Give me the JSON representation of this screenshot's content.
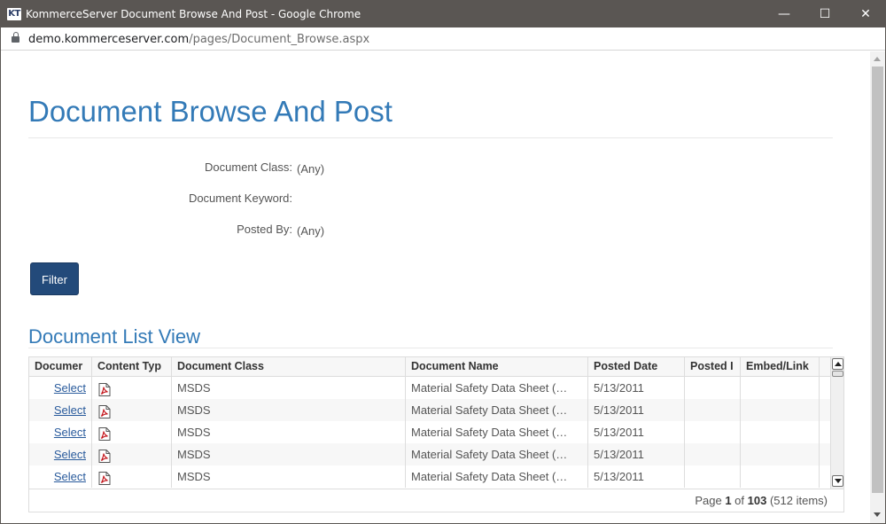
{
  "window": {
    "title": "KommerceServer Document Browse And Post - Google Chrome",
    "logo": "KT",
    "controls": {
      "minimize": "—",
      "maximize": "☐",
      "close": "✕"
    }
  },
  "address": {
    "host": "demo.kommerceserver.com",
    "path": "/pages/Document_Browse.aspx"
  },
  "page": {
    "title": "Document Browse And Post",
    "filters": [
      {
        "label": "Document Class:",
        "value": "(Any)"
      },
      {
        "label": "Document Keyword:",
        "value": ""
      },
      {
        "label": "Posted By:",
        "value": "(Any)"
      }
    ],
    "filter_button": "Filter",
    "section_title": "Document List View"
  },
  "grid": {
    "headers": [
      "Documer",
      "Content Typ",
      "Document Class",
      "Document Name",
      "Posted Date",
      "Posted I",
      "Embed/Link"
    ],
    "rows": [
      {
        "action": "Select",
        "content_type": "pdf-icon",
        "class": "MSDS",
        "name": "Material Safety Data Sheet (…",
        "date": "5/13/2011",
        "posted_by": "",
        "embed": ""
      },
      {
        "action": "Select",
        "content_type": "pdf-icon",
        "class": "MSDS",
        "name": "Material Safety Data Sheet (…",
        "date": "5/13/2011",
        "posted_by": "",
        "embed": ""
      },
      {
        "action": "Select",
        "content_type": "pdf-icon",
        "class": "MSDS",
        "name": "Material Safety Data Sheet (…",
        "date": "5/13/2011",
        "posted_by": "",
        "embed": ""
      },
      {
        "action": "Select",
        "content_type": "pdf-icon",
        "class": "MSDS",
        "name": "Material Safety Data Sheet (…",
        "date": "5/13/2011",
        "posted_by": "",
        "embed": ""
      },
      {
        "action": "Select",
        "content_type": "pdf-icon",
        "class": "MSDS",
        "name": "Material Safety Data Sheet (…",
        "date": "5/13/2011",
        "posted_by": "",
        "embed": ""
      }
    ],
    "pager": {
      "prefix": "Page",
      "current": "1",
      "of": "of",
      "total": "103",
      "items": "(512 items)"
    }
  },
  "colors": {
    "accent": "#337ab7",
    "button": "#234a7a",
    "titlebar": "#5a5653"
  }
}
